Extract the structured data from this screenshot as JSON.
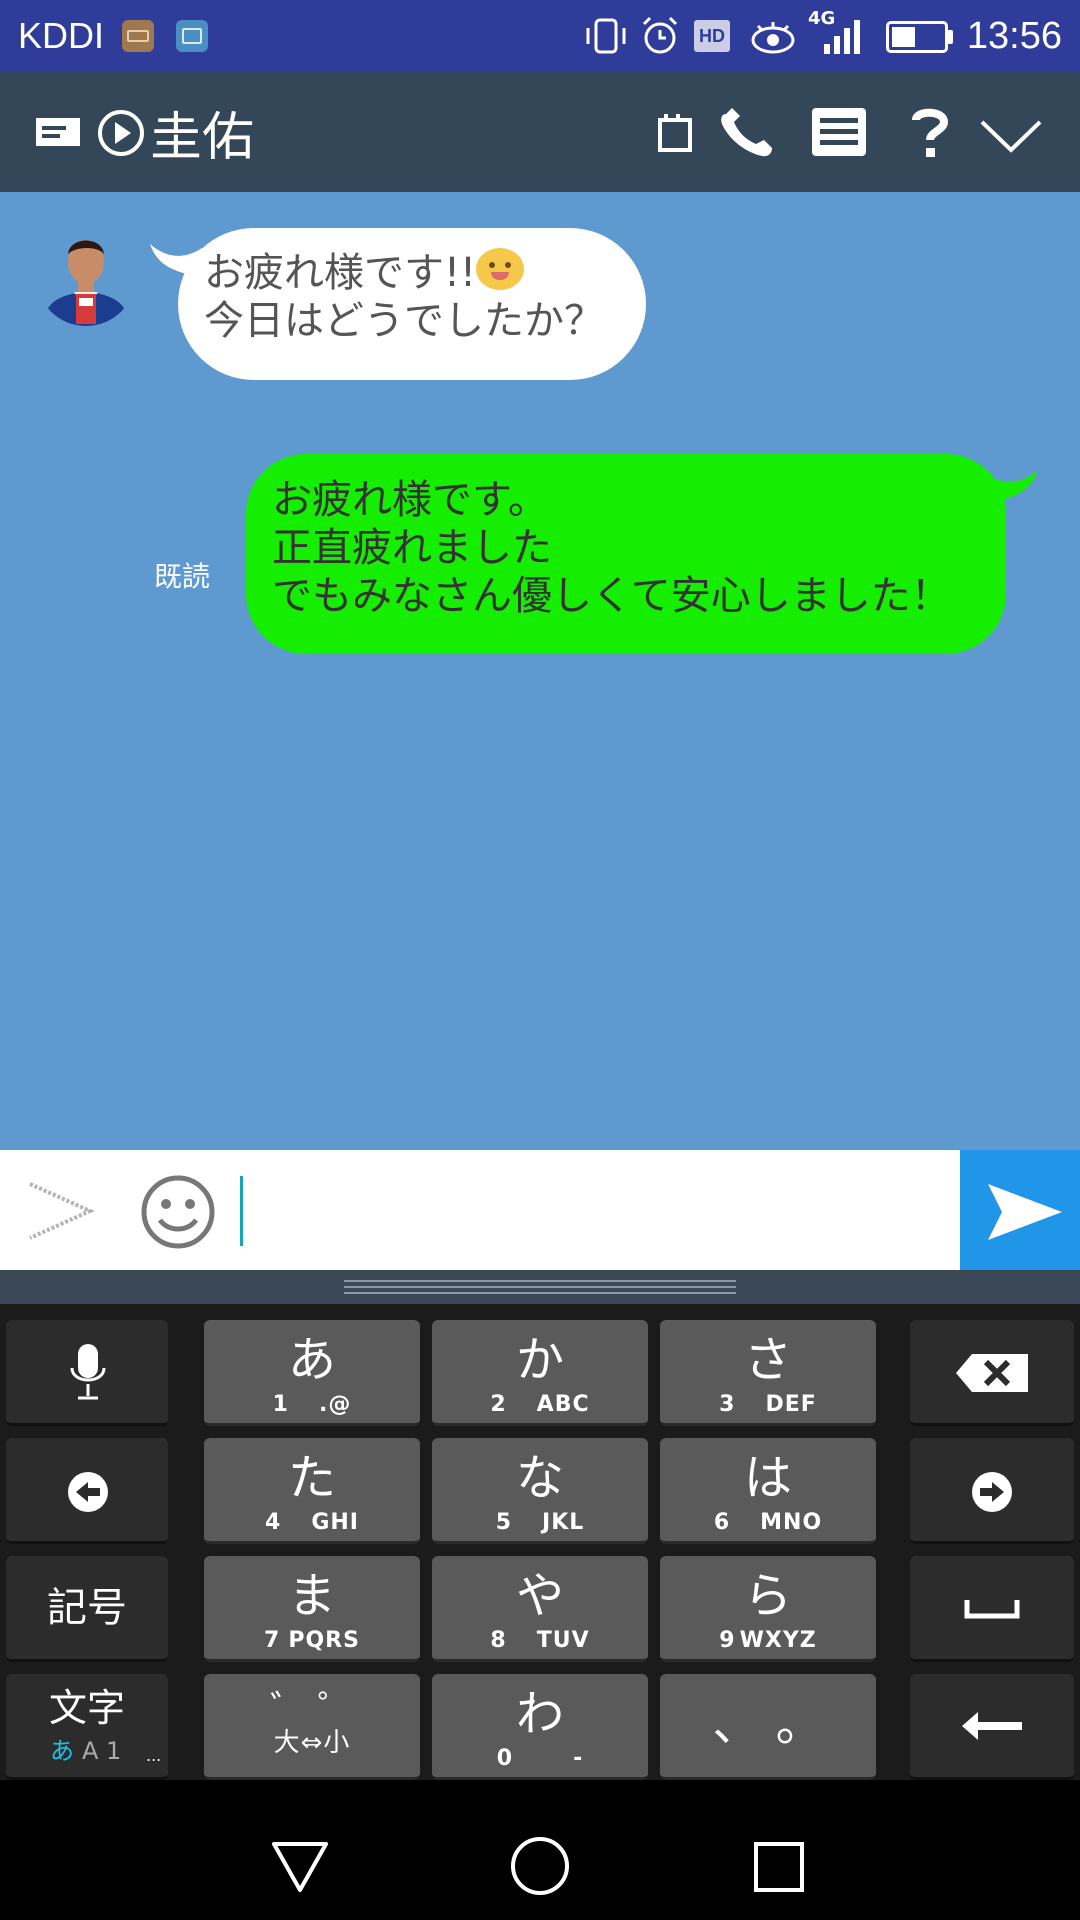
{
  "status_bar": {
    "carrier": "KDDI",
    "time": "13:56",
    "network": "4G",
    "hd_badge": "HD",
    "battery_level": 0.45,
    "icons": [
      "keyboard-notification-icon",
      "image-notification-icon",
      "vibrate-icon",
      "alarm-icon",
      "hd-icon",
      "eye-comfort-icon",
      "signal-icon",
      "battery-icon"
    ]
  },
  "header": {
    "contact_name": "圭佑",
    "icons": [
      "message-icon",
      "play-icon",
      "notepad-icon",
      "phone-icon",
      "menu-icon",
      "help-icon",
      "collapse-chevron-icon"
    ]
  },
  "chat": {
    "messages": [
      {
        "direction": "incoming",
        "lines": [
          "お疲れ様です!!",
          "今日はどうでしたか？"
        ],
        "emoji": "grinning-face-icon",
        "bubble_color": "#ffffff"
      },
      {
        "direction": "outgoing",
        "lines": [
          "お疲れ様です。",
          "正直疲れました",
          "でもみなさん優しくて安心しました！"
        ],
        "read_label": "既読",
        "bubble_color": "#15ee01"
      }
    ],
    "background_color": "#5e9ad0"
  },
  "input_bar": {
    "value": "",
    "send_color": "#2196e8"
  },
  "keyboard": {
    "keys": [
      {
        "kana": "あ",
        "num": "1",
        "letters": ".@"
      },
      {
        "kana": "か",
        "num": "2",
        "letters": "ABC"
      },
      {
        "kana": "さ",
        "num": "3",
        "letters": "DEF"
      },
      {
        "kana": "た",
        "num": "4",
        "letters": "GHI"
      },
      {
        "kana": "な",
        "num": "5",
        "letters": "JKL"
      },
      {
        "kana": "は",
        "num": "6",
        "letters": "MNO"
      },
      {
        "kana": "ま",
        "num": "7",
        "letters": "PQRS"
      },
      {
        "kana": "や",
        "num": "8",
        "letters": "TUV"
      },
      {
        "kana": "ら",
        "num": "9",
        "letters": "WXYZ"
      },
      {
        "kana": "゛ ゜",
        "num": "",
        "letters": "大⇔小"
      },
      {
        "kana": "わ",
        "num": "0",
        "letters": "-"
      },
      {
        "kana": "、 。",
        "num": "",
        "letters": ""
      }
    ],
    "symbol_key": "記号",
    "mode_key": "文字",
    "mode_sub_a": "あ",
    "mode_sub_rest": "A 1",
    "mode_more": "..."
  },
  "navbar": {
    "icons": [
      "back-triangle-icon",
      "home-circle-icon",
      "recents-square-icon"
    ]
  }
}
